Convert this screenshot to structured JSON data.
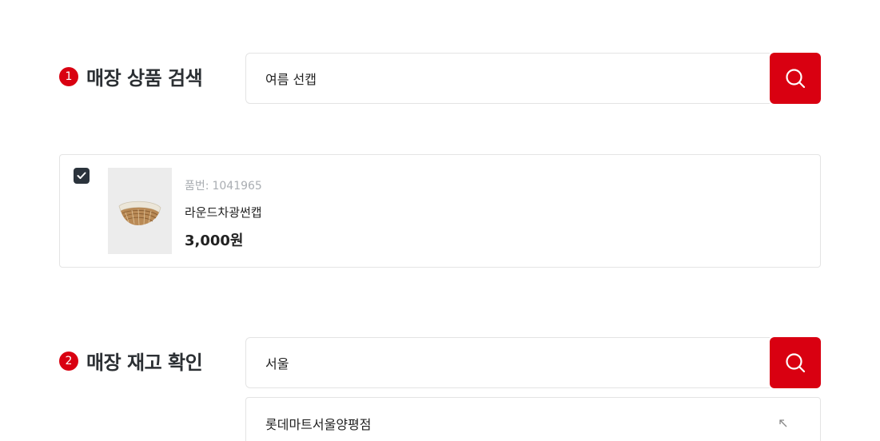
{
  "section1": {
    "step": "1",
    "title": "매장 상품 검색",
    "search_value": "여름 선캡",
    "search_icon": "search-icon"
  },
  "product": {
    "checked": true,
    "item_no_label": "품번:",
    "item_no": "1041965",
    "name": "라운드차광썬캡",
    "price": "3,000원"
  },
  "section2": {
    "step": "2",
    "title": "매장 재고 확인",
    "search_value": "서울",
    "search_icon": "search-icon",
    "suggestions": [
      {
        "label": "롯데마트서울양평점",
        "icon": "arrow-up-left-icon"
      }
    ]
  },
  "colors": {
    "accent": "#d90011",
    "checkbox": "#2b333c",
    "border": "#e4e4e4",
    "muted_text": "#a9adb2"
  }
}
